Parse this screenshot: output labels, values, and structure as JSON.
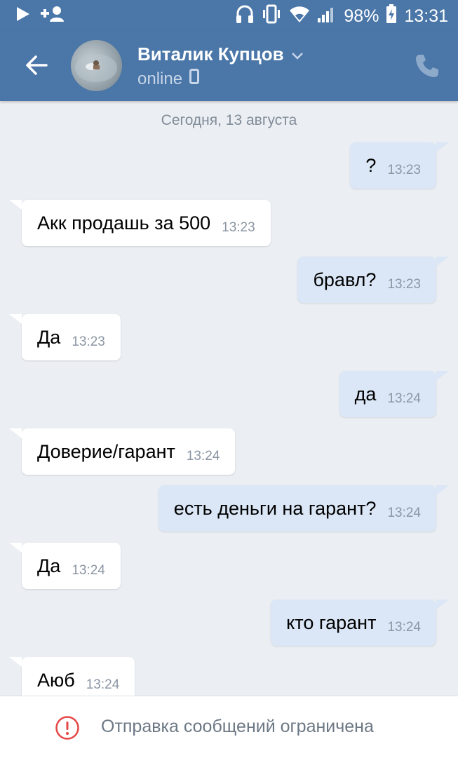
{
  "statusbar": {
    "battery": "98%",
    "time": "13:31",
    "icons": [
      "play-icon",
      "add-user-icon",
      "headphones-icon",
      "vibrate-icon",
      "wifi-icon",
      "signal-icon",
      "battery-icon"
    ]
  },
  "header": {
    "name": "Виталик Купцов",
    "status": "online",
    "icons": [
      "back-arrow-icon",
      "chevron-down-icon",
      "mobile-icon",
      "phone-icon"
    ]
  },
  "date_label": "Сегодня, 13 августа",
  "messages": [
    {
      "dir": "out",
      "text": "?",
      "time": "13:23"
    },
    {
      "dir": "in",
      "text": "Акк продашь за 500",
      "time": "13:23"
    },
    {
      "dir": "out",
      "text": "бравл?",
      "time": "13:23"
    },
    {
      "dir": "in",
      "text": "Да",
      "time": "13:23"
    },
    {
      "dir": "out",
      "text": "да",
      "time": "13:24"
    },
    {
      "dir": "in",
      "text": "Доверие/гарант",
      "time": "13:24"
    },
    {
      "dir": "out",
      "text": "есть деньги на гарант?",
      "time": "13:24"
    },
    {
      "dir": "in",
      "text": "Да",
      "time": "13:24"
    },
    {
      "dir": "out",
      "text": "кто гарант",
      "time": "13:24"
    },
    {
      "dir": "in",
      "text": "Аюб",
      "time": "13:24"
    }
  ],
  "footer": {
    "text": "Отправка сообщений ограничена",
    "icon": "alert-icon",
    "alert_color": "#e64646"
  },
  "colors": {
    "header": "#4a76a8",
    "background": "#ebeef2",
    "outgoing_bubble": "#dbe7f6",
    "incoming_bubble": "#ffffff"
  }
}
